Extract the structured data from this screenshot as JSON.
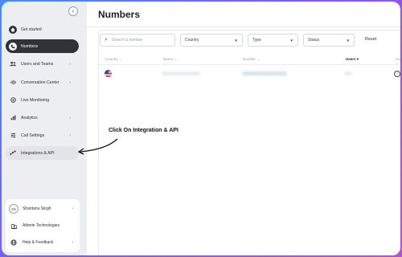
{
  "sidebar": {
    "collapse_icon": "chevron-left-icon",
    "items": [
      {
        "label": "Get started",
        "icon": "home-icon"
      },
      {
        "label": "Numbers",
        "icon": "phone-icon"
      },
      {
        "label": "Users and Teams",
        "icon": "users-icon"
      },
      {
        "label": "Conversation Center",
        "icon": "audio-wave-icon"
      },
      {
        "label": "Live Monitoring",
        "icon": "headset-icon"
      },
      {
        "label": "Analytics",
        "icon": "bar-chart-icon"
      },
      {
        "label": "Call Settings",
        "icon": "sliders-icon"
      },
      {
        "label": "Integrations & API",
        "icon": "integrations-icon"
      }
    ],
    "bottom": {
      "user": {
        "initials": "SS",
        "name": "Shantanu Singh"
      },
      "company": {
        "name": "Athmin Technologies"
      },
      "help": {
        "label": "Help & Feedback"
      }
    }
  },
  "main": {
    "title": "Numbers",
    "search_placeholder": "Search a number",
    "filters": {
      "country": "Country",
      "type": "Type",
      "status": "Status",
      "reset": "Reset"
    },
    "columns": [
      "Country",
      "Name",
      "Number",
      "Users",
      "Ca"
    ]
  },
  "annotation": {
    "text": "Click On Integration & API"
  },
  "colors": {
    "active_bg": "#2f3338",
    "sidebar_bg": "#eceef1",
    "frame_gradient_start": "#4a8cf0",
    "frame_gradient_end": "#c04ae0"
  }
}
